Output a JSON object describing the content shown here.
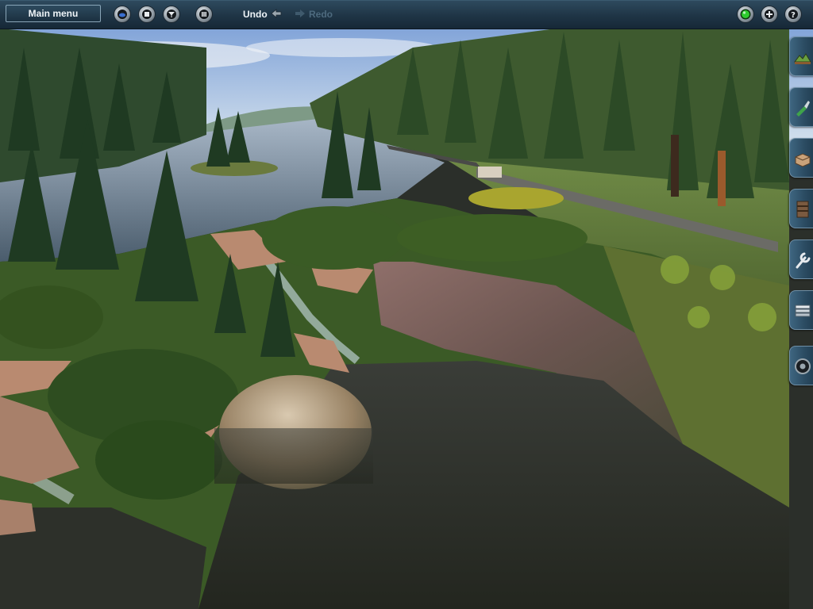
{
  "toolbar": {
    "main_menu_label": "Main menu",
    "undo_label": "Undo",
    "redo_label": "Redo"
  },
  "toolbar_icons": {
    "left": [
      "view-mode-icon",
      "stop-icon",
      "filter-icon",
      "grid-icon"
    ],
    "right": [
      "status-indicator-icon",
      "add-icon",
      "help-icon"
    ]
  },
  "side_palette": [
    "terrain-tool-icon",
    "paint-tool-icon",
    "object-tool-icon",
    "track-tool-icon",
    "wrench-tool-icon",
    "layers-tool-icon",
    "settings-tool-icon"
  ],
  "colors": {
    "toolbar": "#1f3546",
    "indicator_green": "#2ecc2e",
    "disabled_text": "#4d6a7e"
  }
}
